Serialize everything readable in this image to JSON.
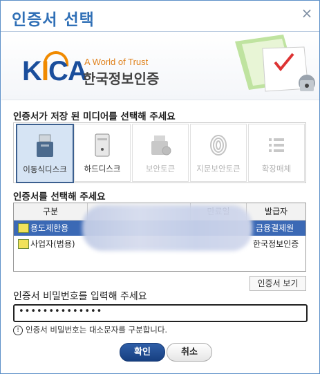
{
  "window": {
    "title": "인증서 선택"
  },
  "banner": {
    "tagline": "A World of Trust",
    "logo_text": "KICA",
    "org_name": "한국정보인증"
  },
  "media_section": {
    "label": "인증서가 저장 된 미디어를 선택해 주세요",
    "items": [
      {
        "label": "이동식디스크",
        "icon": "usb-drive-icon",
        "state": "selected"
      },
      {
        "label": "하드디스크",
        "icon": "hard-disk-icon",
        "state": "enabled"
      },
      {
        "label": "보안토큰",
        "icon": "security-token-icon",
        "state": "disabled"
      },
      {
        "label": "지문보안토큰",
        "icon": "fingerprint-icon",
        "state": "disabled"
      },
      {
        "label": "확장매체",
        "icon": "extended-media-icon",
        "state": "disabled"
      }
    ]
  },
  "cert_section": {
    "label": "인증서를 선택해 주세요",
    "columns": [
      "구분",
      "",
      "만료일",
      "발급자"
    ],
    "rows": [
      {
        "type": "용도제한용",
        "issuer": "금융결제원",
        "selected": true
      },
      {
        "type": "사업자(범용)",
        "issuer": "한국정보인증",
        "selected": false
      }
    ],
    "view_button": "인증서 보기"
  },
  "password": {
    "label": "인증서 비밀번호를 입력해 주세요",
    "value": "••••••••••••••",
    "hint": "인증서 비밀번호는 대소문자를 구분합니다."
  },
  "buttons": {
    "ok": "확인",
    "cancel": "취소"
  },
  "colors": {
    "accent": "#2f6fb6",
    "selection": "#3b69b5",
    "logo_orange": "#f08a00"
  }
}
